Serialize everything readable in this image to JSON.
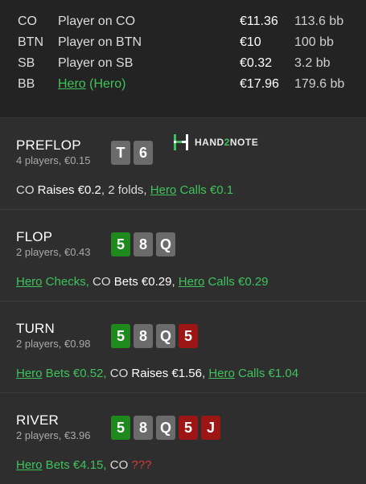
{
  "players": [
    {
      "pos": "CO",
      "name": "Player on CO",
      "hero_suffix": "",
      "eur": "€11.36",
      "bb": "113.6 bb"
    },
    {
      "pos": "BTN",
      "name": "Player on BTN",
      "hero_suffix": "",
      "eur": "€10",
      "bb": "100 bb"
    },
    {
      "pos": "SB",
      "name": "Player on SB",
      "hero_suffix": "",
      "eur": "€0.32",
      "bb": "3.2 bb"
    },
    {
      "pos": "BB",
      "name": "Hero",
      "hero_suffix": " (Hero)",
      "eur": "€17.96",
      "bb": "179.6 bb"
    }
  ],
  "logo": {
    "pre": "HAND",
    "two": "2",
    "post": "NOTE"
  },
  "streets": {
    "preflop": {
      "name": "PREFLOP",
      "sub": "4 players, €0.15",
      "cards": [
        {
          "rank": "T",
          "color": "#6b6b6b"
        },
        {
          "rank": "6",
          "color": "#6b6b6b"
        }
      ],
      "action": {
        "a1": "CO ",
        "a2": "Raises €0.2",
        "a3": ", 2 folds, ",
        "a4": "Hero",
        "a5": " Calls €0.1"
      }
    },
    "flop": {
      "name": "FLOP",
      "sub": "2 players, €0.43",
      "cards": [
        {
          "rank": "5",
          "color": "#1e8a1e"
        },
        {
          "rank": "8",
          "color": "#6b6b6b"
        },
        {
          "rank": "Q",
          "color": "#6b6b6b"
        }
      ],
      "action": {
        "a1": "Hero",
        "a2": " Checks, ",
        "a3": "CO ",
        "a4": "Bets €0.29",
        "a5": ", ",
        "a6": "Hero",
        "a7": " Calls €0.29"
      }
    },
    "turn": {
      "name": "TURN",
      "sub": "2 players, €0.98",
      "cards": [
        {
          "rank": "5",
          "color": "#1e8a1e"
        },
        {
          "rank": "8",
          "color": "#6b6b6b"
        },
        {
          "rank": "Q",
          "color": "#6b6b6b"
        },
        {
          "rank": "5",
          "color": "#9c1616"
        }
      ],
      "action": {
        "a1": "Hero",
        "a2": " Bets €0.52, ",
        "a3": "CO ",
        "a4": "Raises €1.56",
        "a5": ", ",
        "a6": "Hero",
        "a7": " Calls €1.04"
      }
    },
    "river": {
      "name": "RIVER",
      "sub": "2 players, €3.96",
      "cards": [
        {
          "rank": "5",
          "color": "#1e8a1e"
        },
        {
          "rank": "8",
          "color": "#6b6b6b"
        },
        {
          "rank": "Q",
          "color": "#6b6b6b"
        },
        {
          "rank": "5",
          "color": "#9c1616"
        },
        {
          "rank": "J",
          "color": "#9c1616"
        }
      ],
      "action": {
        "a1": "Hero",
        "a2": " Bets €4.15, ",
        "a3": "CO ",
        "a4": "???"
      }
    }
  }
}
